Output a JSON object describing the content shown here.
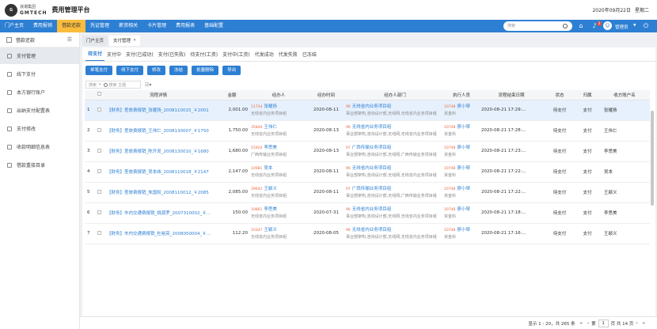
{
  "header": {
    "brand_cn": "浪潮集团",
    "brand_en": "GMTECH",
    "app_title": "费用管理平台",
    "date": "2020年09月22日",
    "weekday": "星期二"
  },
  "nav": {
    "items": [
      "门户主页",
      "费用报销",
      "借款还款",
      "凭证管理",
      "薪资相关",
      "卡片管理",
      "费用报表",
      "基础配置"
    ],
    "active_index": 2,
    "search_placeholder": "搜索",
    "notify_count": "3",
    "user": "管理员"
  },
  "sidebar": {
    "header": "借款还款",
    "items": [
      "支付管理",
      "线下支付",
      "本方银行账户",
      "出纳支付配置表",
      "支付修改",
      "收款明细信息表",
      "借款重接目录"
    ],
    "active_index": 0
  },
  "page_tabs": [
    {
      "label": "门户主页",
      "closable": false
    },
    {
      "label": "支付管理",
      "closable": true
    }
  ],
  "sub_tabs": {
    "items": [
      "待支付",
      "支付中",
      "支付(已成功)",
      "支付(已失败)",
      "待支付(工资)",
      "支付中(工资)",
      "代发成功",
      "代发失败",
      "已冻结"
    ],
    "active_index": 0
  },
  "toolbar": {
    "buttons": [
      "单笔支付",
      "线下支付",
      "修改",
      "冻结",
      "批量删除",
      "导出"
    ]
  },
  "filter": {
    "option": "搜索",
    "placeholder": "搜索 主题"
  },
  "table": {
    "columns": [
      "流程详情",
      "金额",
      "经办人",
      "经办时间",
      "经办人部门",
      "执行人员",
      "流程结束日期",
      "状态",
      "归属",
      "收方账户名"
    ],
    "rows": [
      {
        "idx": "1",
        "detail": "【财务】差旅费报销_张耀扬_2008110015_￥2001",
        "amount": "2,001.00",
        "agent_code": "11734",
        "agent_name": "张耀扬",
        "agent_dept": "无线省内业务项目组",
        "time": "2020-08-11",
        "dept_code": "96",
        "dept_name": "无线省内业务项目组",
        "dept_path": "事业部架构,咨询设计部,无线网,无线省内业务项目组",
        "exec_code": "10748",
        "exec_name": "廖小琴",
        "exec_dept": "资金科",
        "end": "2020-08-21 17:29:...",
        "status": "待支付",
        "owner": "支付",
        "payee": "张耀扬"
      },
      {
        "idx": "2",
        "detail": "【财务】差旅费报销_王伟仁_2008130007_￥1750",
        "amount": "1,750.00",
        "agent_code": "35840",
        "agent_name": "王伟仁",
        "agent_dept": "无线省内业务项目组",
        "time": "2020-08-13",
        "dept_code": "96",
        "dept_name": "无线省内业务项目组",
        "dept_path": "事业部架构,咨询设计部,无线网,无线省内业务项目组",
        "exec_code": "10748",
        "exec_name": "廖小琴",
        "exec_dept": "资金科",
        "end": "2020-08-21 17:28:...",
        "status": "待支付",
        "owner": "支付",
        "payee": "王伟仁"
      },
      {
        "idx": "3",
        "detail": "【财务】差旅费报销_陈开发_2008130010_￥1680",
        "amount": "1,680.00",
        "agent_code": "15924",
        "agent_name": "李思美",
        "agent_dept": "广西传输业务项目组",
        "time": "2020-08-13",
        "dept_code": "97",
        "dept_name": "广西传输业务项目组",
        "dept_path": "事业部架构,咨询设计部,无线网,广西传输业务项目组",
        "exec_code": "10748",
        "exec_name": "廖小琴",
        "exec_dept": "资金科",
        "end": "2020-08-21 17:23:...",
        "status": "待支付",
        "owner": "支付",
        "payee": "李思美"
      },
      {
        "idx": "4",
        "detail": "【财务】差旅费报销_吴本纬_2008110018_￥2147",
        "amount": "2,147.00",
        "agent_code": "10081",
        "agent_name": "吴本",
        "agent_dept": "无线省内业务项目组",
        "time": "2020-08-11",
        "dept_code": "96",
        "dept_name": "无线省内业务项目组",
        "dept_path": "事业部架构,咨询设计部,无线网,无线省内业务项目组",
        "exec_code": "10748",
        "exec_name": "廖小琴",
        "exec_dept": "资金科",
        "end": "2020-08-21 17:22:...",
        "status": "待支付",
        "owner": "支付",
        "payee": "吴本"
      },
      {
        "idx": "5",
        "detail": "【财务】差旅费报销_朱国权_2008110012_￥2085",
        "amount": "2,085.00",
        "agent_code": "29642",
        "agent_name": "王颖义",
        "agent_dept": "无线省内业务项目组",
        "time": "2020-08-11",
        "dept_code": "97",
        "dept_name": "广西传输业务项目组",
        "dept_path": "事业部架构,咨询设计部,无线网,广西传输业务项目组",
        "exec_code": "10748",
        "exec_name": "廖小琴",
        "exec_dept": "资金科",
        "end": "2020-08-21 17:22:...",
        "status": "待支付",
        "owner": "支付",
        "payee": "王颖义"
      },
      {
        "idx": "6",
        "detail": "【财务】市内交通费报销_姚源罗_2007310002_￥1...",
        "amount": "150.00",
        "agent_code": "10861",
        "agent_name": "李思美",
        "agent_dept": "无线省内业务项目组",
        "time": "2020-07-31",
        "dept_code": "96",
        "dept_name": "无线省内业务项目组",
        "dept_path": "事业部架构,咨询设计部,无线网,无线省内业务项目组",
        "exec_code": "10748",
        "exec_name": "廖小琴",
        "exec_dept": "资金科",
        "end": "2020-08-21 17:18:...",
        "status": "待支付",
        "owner": "支付",
        "payee": "李思美"
      },
      {
        "idx": "7",
        "detail": "【财务】市内交通费报销_杜裕亮_2008050004_￥1...",
        "amount": "112.20",
        "agent_code": "10347",
        "agent_name": "王颖义",
        "agent_dept": "无线省内业务项目组",
        "time": "2020-08-05",
        "dept_code": "96",
        "dept_name": "无线省内业务项目组",
        "dept_path": "事业部架构,咨询设计部,无线网,无线省内业务项目组",
        "exec_code": "10748",
        "exec_name": "廖小琴",
        "exec_dept": "资金科",
        "end": "2020-08-21 17:16:...",
        "status": "待支付",
        "owner": "支付",
        "payee": "王颖义"
      }
    ]
  },
  "footer": {
    "summary": "显示 1 - 20，共 265 条",
    "page_prefix": "第",
    "page": "1",
    "page_suffix": "页 共 14 页"
  }
}
